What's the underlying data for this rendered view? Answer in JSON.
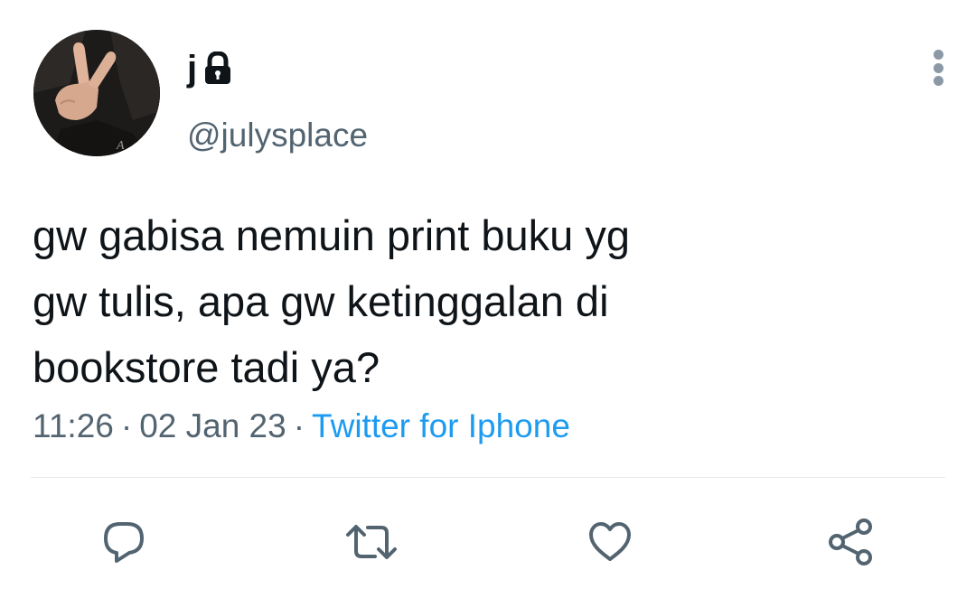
{
  "user": {
    "display_name": "j",
    "handle": "@julysplace",
    "protected": true,
    "avatar": "profile-photo"
  },
  "tweet": {
    "text_lines": [
      "gw gabisa nemuin print buku yg",
      "gw tulis, apa gw ketinggalan di",
      "bookstore tadi ya?"
    ],
    "time": "11:26",
    "date": "02 Jan 23",
    "separator": "·",
    "source": "Twitter for Iphone"
  },
  "actions": [
    {
      "icon": "reply-icon"
    },
    {
      "icon": "retweet-icon"
    },
    {
      "icon": "like-icon"
    },
    {
      "icon": "share-icon"
    }
  ],
  "colors": {
    "text": "#0f1419",
    "secondary": "#536471",
    "link": "#1d9bf0",
    "icon": "#536471",
    "divider": "#e6e9eb"
  }
}
